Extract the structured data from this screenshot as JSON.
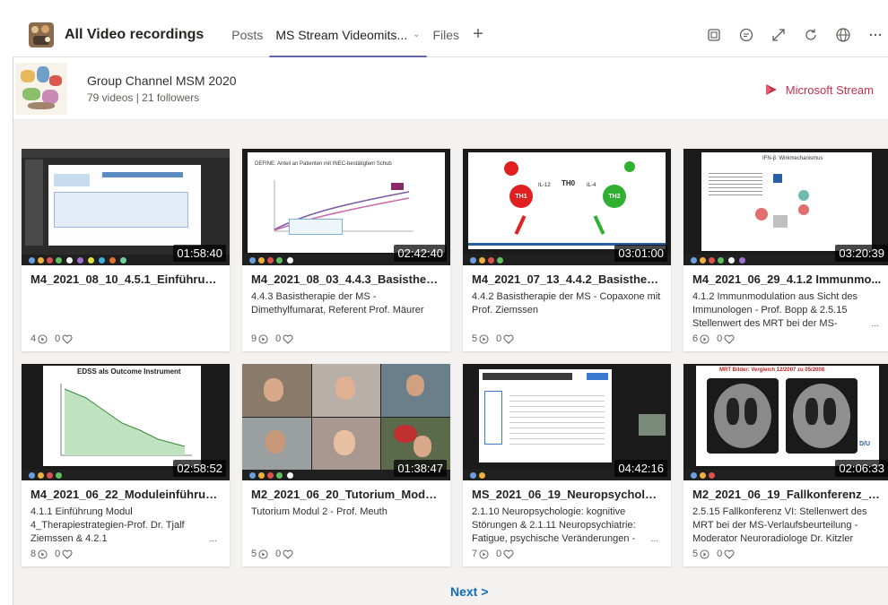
{
  "header": {
    "channel_title": "All Video recordings",
    "tabs": [
      {
        "label": "Posts",
        "active": false
      },
      {
        "label": "MS Stream Videomits...",
        "active": true
      },
      {
        "label": "Files",
        "active": false
      }
    ],
    "toolbar_icons": [
      "tab-settings-icon",
      "conversation-icon",
      "expand-icon",
      "refresh-icon",
      "globe-icon",
      "more-options-icon"
    ]
  },
  "group": {
    "name": "Group Channel MSM 2020",
    "meta": "79 videos | 21 followers",
    "stream_label": "Microsoft Stream"
  },
  "videos": [
    {
      "title": "M4_2021_08_10_4.5.1_Einführung ...",
      "description": "",
      "duration": "01:58:40",
      "views": "4",
      "likes": "0"
    },
    {
      "title": "M4_2021_08_03_4.4.3_Basisthera...",
      "description": "4.4.3 Basistherapie der MS - Dimethylfumarat, Referent Prof. Mäurer",
      "duration": "02:42:40",
      "views": "9",
      "likes": "0"
    },
    {
      "title": "M4_2021_07_13_4.4.2_Basisthera...",
      "description": "4.4.2 Basistherapie der MS - Copaxone mit Prof. Ziemssen",
      "duration": "03:01:00",
      "views": "5",
      "likes": "0"
    },
    {
      "title": "M4_2021_06_29_4.1.2 Immunmo...",
      "description": "4.1.2 Immunmodulation aus Sicht des Immunologen - Prof. Bopp & 2.5.15 Stellenwert des MRT bei der MS-",
      "duration": "03:20:39",
      "views": "6",
      "likes": "0"
    },
    {
      "title": "M4_2021_06_22_Moduleinführun...",
      "description": "4.1.1 Einführung Modul 4_Therapiestrategien-Prof. Dr. Tjalf Ziemssen & 4.2.1",
      "duration": "02:58:52",
      "views": "8",
      "likes": "0"
    },
    {
      "title": "M2_2021_06_20_Tutorium_Modul...",
      "description": "Tutorium Modul 2 - Prof. Meuth",
      "duration": "01:38:47",
      "views": "5",
      "likes": "0"
    },
    {
      "title": "MS_2021_06_19_Neuropsychologi...",
      "description": "2.1.10 Neuropsychologie: kognitive Störungen & 2.1.11 Neuropsychiatrie: Fatigue, psychische Veränderungen -",
      "duration": "04:42:16",
      "views": "7",
      "likes": "0"
    },
    {
      "title": "M2_2021_06_19_Fallkonferenz_M...",
      "description": "2.5.15 Fallkonferenz VI: Stellenwert des MRT bei der MS-Verlaufsbeurteilung - Moderator Neuroradiologe Dr. Kitzler",
      "duration": "02:06:33",
      "views": "5",
      "likes": "0"
    }
  ],
  "thumb_text": {
    "slide2": "DEFINE: Anteil an Patienten mit INEC-bestätigtem Schub",
    "slide3_nodes": [
      "TH1",
      "TH0",
      "TH2"
    ],
    "slide3_arrows": [
      "IL-12",
      "IL-4"
    ],
    "slide4": "IFN-β: Wirkmechanismus",
    "slide5": "EDSS als Outcome Instrument",
    "slide8": "MRT Bilder: Vergleich 12/2007 zu 05/2008",
    "slide8_label": "D/U"
  },
  "more_marker": "...",
  "pagination": {
    "next_label": "Next >"
  }
}
